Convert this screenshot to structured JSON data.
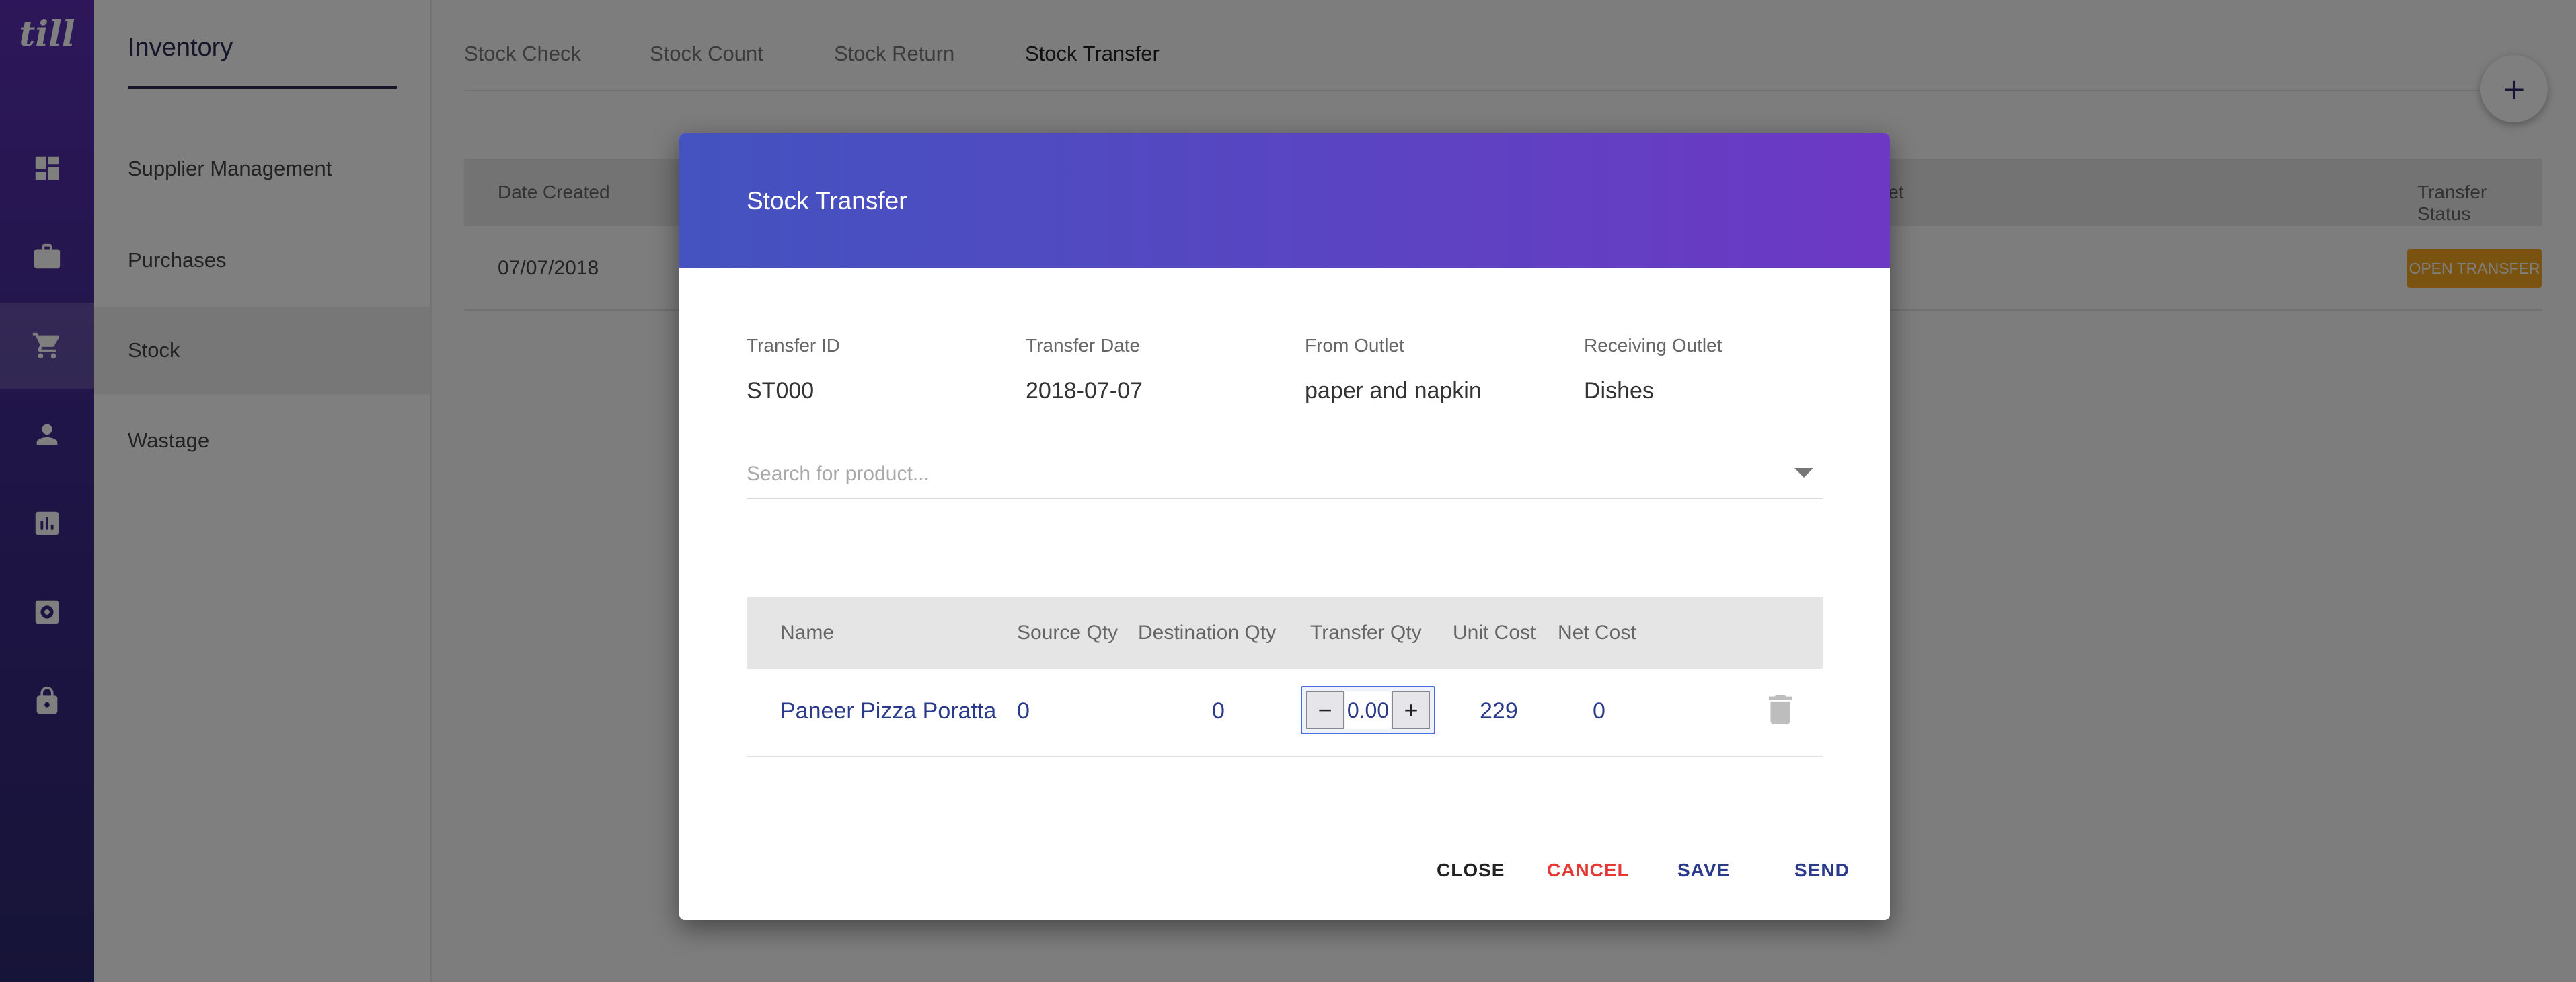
{
  "app": {
    "logo": "till",
    "section_title": "Inventory",
    "nav_icons": [
      "dashboard-icon",
      "briefcase-icon",
      "cart-icon",
      "person-icon",
      "bar-chart-icon",
      "settings-icon",
      "lock-icon"
    ],
    "sub_nav": [
      {
        "label": "Supplier Management"
      },
      {
        "label": "Purchases"
      },
      {
        "label": "Stock",
        "active": true
      },
      {
        "label": "Wastage"
      }
    ],
    "tabs": [
      "Stock Check",
      "Stock Count",
      "Stock Return",
      "Stock Transfer"
    ],
    "active_tab": "Stock Transfer",
    "add_button": "+",
    "list": {
      "headers": {
        "date_created": "Date Created",
        "outlet": "Outlet",
        "transfer_status": "Transfer Status"
      },
      "rows": [
        {
          "date": "07/07/2018",
          "status": "OPEN TRANSFER"
        }
      ]
    }
  },
  "dialog": {
    "title": "Stock Transfer",
    "fields": {
      "transfer_id": {
        "label": "Transfer ID",
        "value": "ST000"
      },
      "transfer_date": {
        "label": "Transfer Date",
        "value": "2018-07-07"
      },
      "from_outlet": {
        "label": "From Outlet",
        "value": "paper and napkin"
      },
      "receiving_outlet": {
        "label": "Receiving Outlet",
        "value": "Dishes"
      }
    },
    "search_placeholder": "Search for product...",
    "table": {
      "headers": {
        "name": "Name",
        "source_qty": "Source Qty",
        "destination_qty": "Destination Qty",
        "transfer_qty": "Transfer Qty",
        "unit_cost": "Unit Cost",
        "net_cost": "Net Cost"
      },
      "rows": [
        {
          "name": "Paneer Pizza Poratta",
          "source_qty": "0",
          "destination_qty": "0",
          "transfer_qty": "0.00",
          "unit_cost": "229",
          "net_cost": "0"
        }
      ]
    },
    "stepper": {
      "minus": "−",
      "plus": "+"
    },
    "actions": {
      "close": "CLOSE",
      "cancel": "CANCEL",
      "save": "SAVE",
      "send": "SEND"
    }
  },
  "colors": {
    "accent": "#2a3a8a",
    "header_gradient_start": "#4353bf",
    "header_gradient_end": "#6d38c4",
    "cancel": "#e53935",
    "status_chip": "#f5a623"
  }
}
